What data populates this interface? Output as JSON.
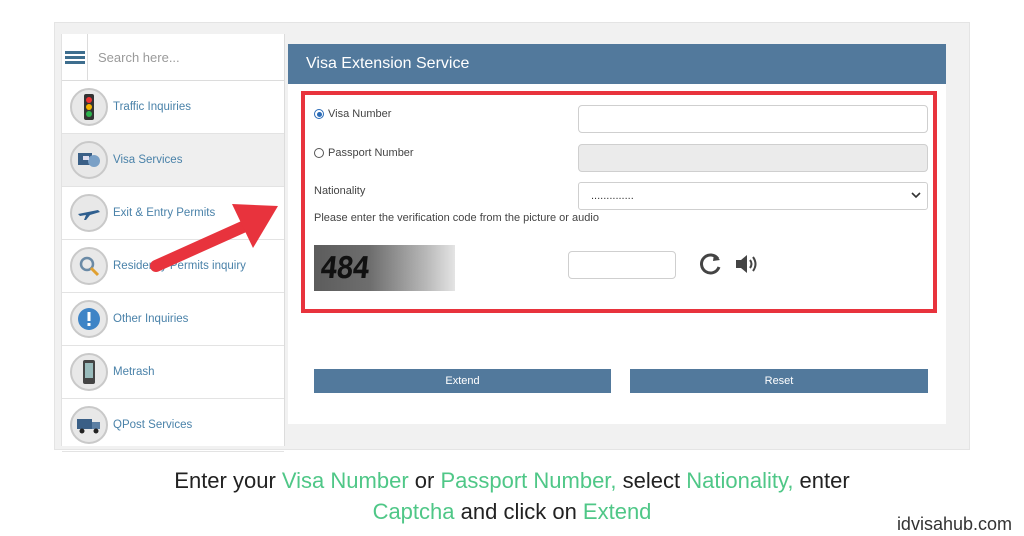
{
  "sidebar": {
    "search_placeholder": "Search here...",
    "items": [
      {
        "label": "Traffic Inquiries",
        "icon": "traffic-light-icon"
      },
      {
        "label": "Visa Services",
        "icon": "visa-services-icon"
      },
      {
        "label": "Exit & Entry Permits",
        "icon": "airplane-icon"
      },
      {
        "label": "Residency Permits inquiry",
        "icon": "residency-search-icon"
      },
      {
        "label": "Other Inquiries",
        "icon": "exclamation-icon"
      },
      {
        "label": "Metrash",
        "icon": "phone-device-icon"
      },
      {
        "label": "QPost Services",
        "icon": "post-truck-icon"
      }
    ]
  },
  "panel": {
    "title": "Visa Extension Service",
    "visa_label": "Visa Number",
    "passport_label": "Passport Number",
    "nationality_label": "Nationality",
    "nationality_value": "..............",
    "verification_text": "Please enter the verification code from the picture or audio",
    "captcha_text": "484",
    "extend_label": "Extend",
    "reset_label": "Reset"
  },
  "caption": {
    "line1_a": "Enter your ",
    "line1_b": "Visa Number",
    "line1_c": " or ",
    "line1_d": "Passport Number,",
    "line1_e": " select ",
    "line1_f": "Nationality,",
    "line1_g": " enter",
    "line2_a": "Captcha",
    "line2_b": " and click on ",
    "line2_c": "Extend"
  },
  "brand": "idvisahub.com",
  "colors": {
    "header": "#52799c",
    "highlight": "#e8333d",
    "caption_accent": "#4fc787",
    "arrow": "#e8333d"
  }
}
